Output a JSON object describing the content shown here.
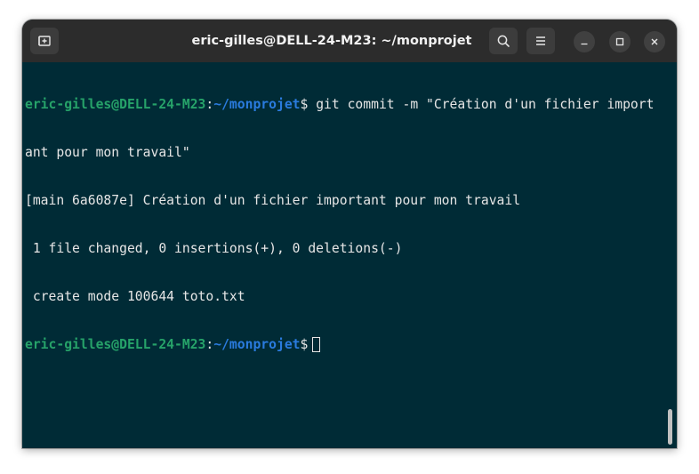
{
  "window": {
    "title": "eric-gilles@DELL-24-M23: ~/monprojet",
    "buttons": {
      "new_tab_icon": "new-tab-icon",
      "search_icon": "search-icon",
      "menu_icon": "hamburger-menu-icon",
      "minimize_icon": "minimize-icon",
      "maximize_icon": "maximize-icon",
      "close_icon": "close-icon"
    }
  },
  "terminal": {
    "prompt1": {
      "user": "eric-gilles@DELL-24-M23",
      "sep": ":",
      "path": "~/monprojet",
      "symbol": "$ ",
      "command": "git commit -m \"Création d'un fichier import"
    },
    "line2": "ant pour mon travail\"",
    "line3": "[main 6a6087e] Création d'un fichier important pour mon travail",
    "line4": " 1 file changed, 0 insertions(+), 0 deletions(-)",
    "line5": " create mode 100644 toto.txt",
    "prompt2": {
      "user": "eric-gilles@DELL-24-M23",
      "sep": ":",
      "path": "~/monprojet",
      "symbol": "$"
    }
  },
  "colors": {
    "terminal_bg": "#002b36",
    "prompt_user": "#26a269",
    "prompt_path": "#2a7bde",
    "titlebar_bg": "#2c2c2c"
  }
}
